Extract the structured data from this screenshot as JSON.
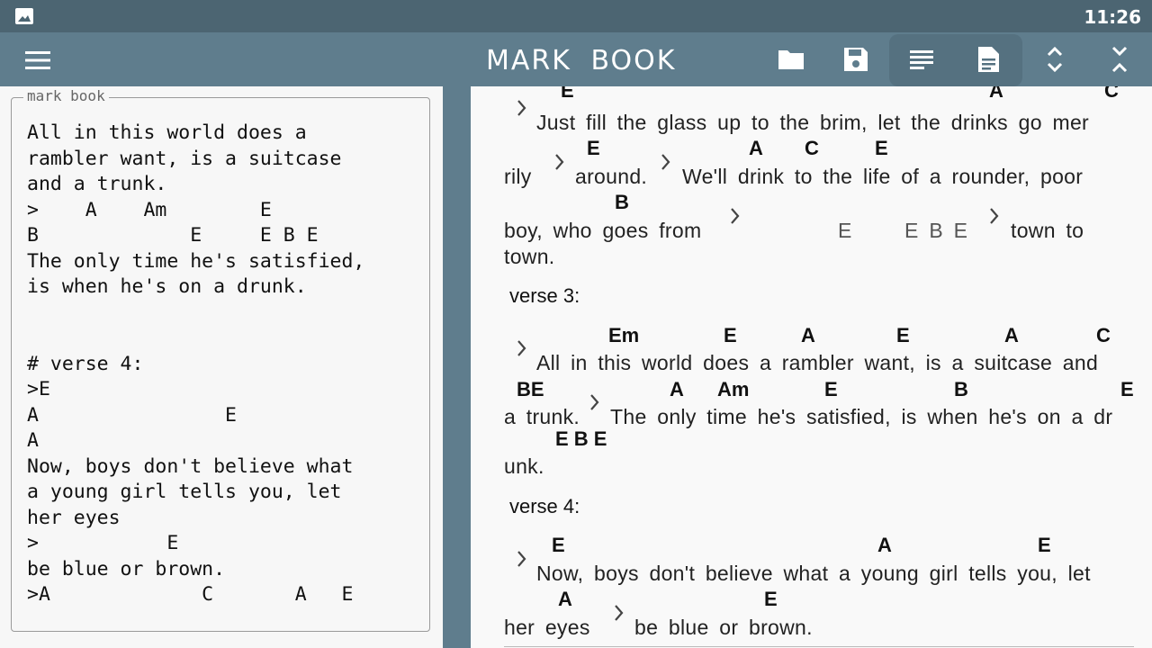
{
  "status": {
    "time": "11:26",
    "icons": [
      "image-icon"
    ]
  },
  "appbar": {
    "title": "MARK BOOK",
    "icons": [
      "menu-icon",
      "folder-icon",
      "save-icon",
      "wrap-text-icon",
      "document-icon",
      "expand-icon",
      "collapse-icon"
    ]
  },
  "editor": {
    "legend": "mark book",
    "text": "All in this world does a\nrambler want, is a suitcase\nand a trunk.\n>    A    Am        E\nB             E     E B E\nThe only time he's satisfied,\nis when he's on a drunk.\n\n\n# verse 4:\n>E\nA                E\nA\nNow, boys don't believe what\na young girl tells you, let\nher eyes\n>           E\nbe blue or brown.\n>A             C       A   E"
  },
  "preview": {
    "partial_chords": [
      "E",
      "A",
      "C"
    ],
    "lines": [
      "Just fill the glass up to the brim, let the drinks go mer",
      "rily",
      "around.",
      "We'll drink to the life of a rounder, poor",
      "boy, who goes from",
      "town to",
      "town.",
      "All in this world does a rambler want, is a suitcase and",
      "a trunk.",
      "The only time he's satisfied, is when he's on a dr",
      "unk.",
      "Now, boys don't believe what a young girl tells you, let",
      "her eyes",
      "be blue or brown."
    ],
    "headings": [
      "verse 3:",
      "verse 4:"
    ],
    "chords": [
      "E",
      "A",
      "C",
      "E",
      "B",
      "E",
      "E B E",
      "Em",
      "E",
      "A",
      "E",
      "A",
      "C",
      "BE",
      "A",
      "Am",
      "E",
      "B",
      "E",
      "E B E",
      "E",
      "A",
      "E",
      "A",
      "E"
    ]
  }
}
